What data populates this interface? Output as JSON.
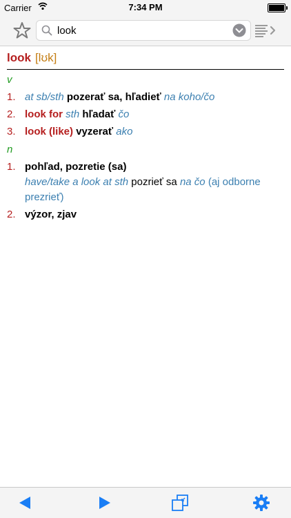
{
  "status": {
    "carrier": "Carrier",
    "time": "7:34 PM"
  },
  "search": {
    "value": "look"
  },
  "entry": {
    "headword": "look",
    "pronunciation": "[lʊk]",
    "verb": {
      "pos": "v",
      "senses": [
        {
          "num": "1.",
          "ctx": "at sb/sth",
          "trans": "pozerať sa, hľadieť",
          "obj": "na koho/čo"
        },
        {
          "num": "2.",
          "phrase": "look for",
          "ctx": "sth",
          "trans": "hľadať",
          "obj": "čo"
        },
        {
          "num": "3.",
          "phrase": "look (like)",
          "trans": "vyzerať",
          "obj": "ako"
        }
      ]
    },
    "noun": {
      "pos": "n",
      "senses": [
        {
          "num": "1.",
          "trans": "pohľad, pozretie (sa)",
          "ex_phrase": "have/take a look at sth",
          "ex_trans": "pozrieť sa",
          "ex_obj": "na čo",
          "ex_note": "(aj odborne prezrieť)"
        },
        {
          "num": "2.",
          "trans": "výzor, zjav"
        }
      ]
    }
  },
  "colors": {
    "accent": "#1a7ef5",
    "headword": "#b51e1e",
    "pron": "#c47d12",
    "pos": "#1f9a1f",
    "italic": "#3b7fb0"
  }
}
